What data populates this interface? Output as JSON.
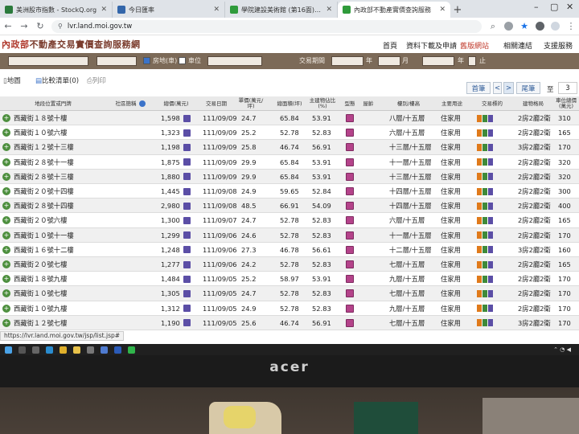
{
  "browser": {
    "tabs": [
      {
        "label": "美洲股市指數 - StockQ.org",
        "color": "#2b7a3c",
        "active": false
      },
      {
        "label": "今日匯率",
        "color": "#3366aa",
        "active": false
      },
      {
        "label": "學院建設美術館 (第16面) - Mob",
        "color": "#2f9b3b",
        "active": false
      },
      {
        "label": "內政部不動產實價查詢服務",
        "color": "#2f9b3b",
        "active": true
      }
    ],
    "url": "lvr.land.moi.gov.tw",
    "status_url": "https://lvr.land.moi.gov.tw/jsp/list.jsp#"
  },
  "site": {
    "logo_prefix": "內政部",
    "logo_title": "不動產交易實價查詢服務網",
    "nav": [
      "首頁",
      "資料下載及申請",
      "舊版網站",
      "相關連結",
      "支援服務"
    ]
  },
  "filters": {
    "checkbox_1": "房地(車)",
    "checkbox_2": "車位",
    "period_label": "交易期間",
    "year_label": "年",
    "month_label": "月",
    "until_label": "止"
  },
  "toolbar": {
    "map_label": "地圖",
    "compare_label": "比較清單(0)",
    "print_label": "列印",
    "first_page": "首筆",
    "prev": "<",
    "next": ">",
    "last_page": "尾筆",
    "page_label": "至",
    "page_value": "3"
  },
  "table": {
    "headers": [
      "地段位置或門牌",
      "社區簡稱",
      "總價(萬元)",
      "交易日期",
      "單價(萬元/坪)",
      "總面積(坪)",
      "主建物佔比(%)",
      "型態",
      "屋齡",
      "樓別/樓高",
      "主要用途",
      "交易標的",
      "建物格局",
      "車位總價(萬元)"
    ],
    "rows": [
      {
        "addr": "西藏街１８號十樓",
        "price": "1,598",
        "date": "111/09/09",
        "unit": "24.7",
        "area": "65.84",
        "ratio": "53.91",
        "floor": "八層/十五層",
        "use": "住家用",
        "layout": "2房2廳2衛",
        "park": "310"
      },
      {
        "addr": "西藏街１０號六樓",
        "price": "1,323",
        "date": "111/09/09",
        "unit": "25.2",
        "area": "52.78",
        "ratio": "52.83",
        "floor": "六層/十五層",
        "use": "住家用",
        "layout": "2房2廳2衛",
        "park": "165"
      },
      {
        "addr": "西藏街１２號十三樓",
        "price": "1,198",
        "date": "111/09/09",
        "unit": "25.8",
        "area": "46.74",
        "ratio": "56.91",
        "floor": "十三層/十五層",
        "use": "住家用",
        "layout": "3房2廳2衛",
        "park": "170"
      },
      {
        "addr": "西藏街２８號十一樓",
        "price": "1,875",
        "date": "111/09/09",
        "unit": "29.9",
        "area": "65.84",
        "ratio": "53.91",
        "floor": "十一層/十五層",
        "use": "住家用",
        "layout": "2房2廳2衛",
        "park": "320"
      },
      {
        "addr": "西藏街２８號十三樓",
        "price": "1,880",
        "date": "111/09/09",
        "unit": "29.9",
        "area": "65.84",
        "ratio": "53.91",
        "floor": "十三層/十五層",
        "use": "住家用",
        "layout": "2房2廳2衛",
        "park": "320"
      },
      {
        "addr": "西藏街２０號十四樓",
        "price": "1,445",
        "date": "111/09/08",
        "unit": "24.9",
        "area": "59.65",
        "ratio": "52.84",
        "floor": "十四層/十五層",
        "use": "住家用",
        "layout": "2房2廳2衛",
        "park": "300"
      },
      {
        "addr": "西藏街２８號十四樓",
        "price": "2,980",
        "date": "111/09/08",
        "unit": "48.5",
        "area": "66.91",
        "ratio": "54.09",
        "floor": "十四層/十五層",
        "use": "住家用",
        "layout": "2房2廳2衛",
        "park": "400"
      },
      {
        "addr": "西藏街２０號六樓",
        "price": "1,300",
        "date": "111/09/07",
        "unit": "24.7",
        "area": "52.78",
        "ratio": "52.83",
        "floor": "六層/十五層",
        "use": "住家用",
        "layout": "2房2廳2衛",
        "park": "165"
      },
      {
        "addr": "西藏街１０號十一樓",
        "price": "1,299",
        "date": "111/09/06",
        "unit": "24.6",
        "area": "52.78",
        "ratio": "52.83",
        "floor": "十一層/十五層",
        "use": "住家用",
        "layout": "2房2廳2衛",
        "park": "170"
      },
      {
        "addr": "西藏街１６號十二樓",
        "price": "1,248",
        "date": "111/09/06",
        "unit": "27.3",
        "area": "46.78",
        "ratio": "56.61",
        "floor": "十二層/十五層",
        "use": "住家用",
        "layout": "3房2廳2衛",
        "park": "160"
      },
      {
        "addr": "西藏街２０號七樓",
        "price": "1,277",
        "date": "111/09/06",
        "unit": "24.2",
        "area": "52.78",
        "ratio": "52.83",
        "floor": "七層/十五層",
        "use": "住家用",
        "layout": "2房2廳2衛",
        "park": "165"
      },
      {
        "addr": "西藏街１８號九樓",
        "price": "1,484",
        "date": "111/09/05",
        "unit": "25.2",
        "area": "58.97",
        "ratio": "53.91",
        "floor": "九層/十五層",
        "use": "住家用",
        "layout": "2房2廳2衛",
        "park": "170"
      },
      {
        "addr": "西藏街１０號七樓",
        "price": "1,305",
        "date": "111/09/05",
        "unit": "24.7",
        "area": "52.78",
        "ratio": "52.83",
        "floor": "七層/十五層",
        "use": "住家用",
        "layout": "2房2廳2衛",
        "park": "170"
      },
      {
        "addr": "西藏街１０號九樓",
        "price": "1,312",
        "date": "111/09/05",
        "unit": "24.9",
        "area": "52.78",
        "ratio": "52.83",
        "floor": "九層/十五層",
        "use": "住家用",
        "layout": "2房2廳2衛",
        "park": "170"
      },
      {
        "addr": "西藏街１２號七樓",
        "price": "1,190",
        "date": "111/09/05",
        "unit": "25.6",
        "area": "46.74",
        "ratio": "56.91",
        "floor": "七層/十五層",
        "use": "住家用",
        "layout": "3房2廳2衛",
        "park": "170"
      }
    ]
  },
  "monitor": {
    "brand": "acer"
  }
}
